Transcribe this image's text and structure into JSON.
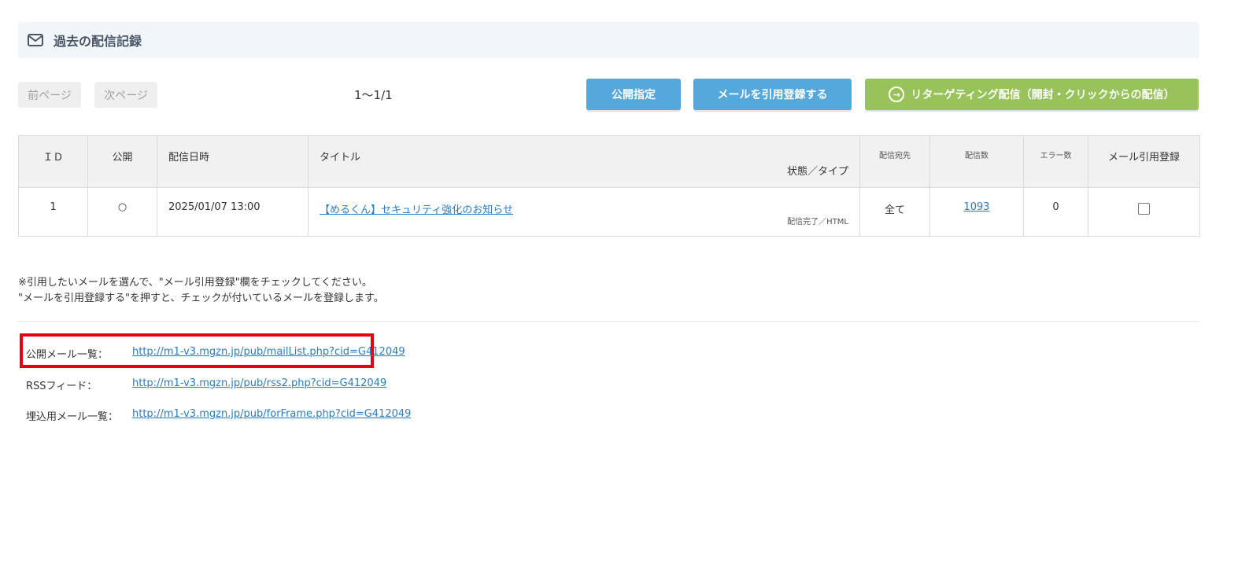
{
  "header": {
    "title": "過去の配信記録",
    "icon": "mail-icon"
  },
  "pager": {
    "prev_label": "前ページ",
    "next_label": "次ページ",
    "page_info": "1〜1/1"
  },
  "actions": {
    "publish_label": "公開指定",
    "quote_register_label": "メールを引用登録する",
    "retargeting_label": "リターゲティング配信（開封・クリックからの配信）",
    "retargeting_icon": "circle-arrow-right-icon"
  },
  "table": {
    "headers": {
      "id": "ＩＤ",
      "public": "公開",
      "date": "配信日時",
      "title": "タイトル",
      "status_type": "状態／タイプ",
      "recipients": "配信宛先",
      "count": "配信数",
      "errors": "エラー数",
      "quote": "メール引用登録"
    },
    "rows": [
      {
        "id": "1",
        "public": "○",
        "date": "2025/01/07 13:00",
        "title": "【めるくん】セキュリティ強化のお知らせ",
        "status_type": "配信完了／HTML",
        "recipients": "全て",
        "count": "1093",
        "errors": "0",
        "quote_checked": false
      }
    ]
  },
  "notes": {
    "line1": "※引用したいメールを選んで、\"メール引用登録\"欄をチェックしてください。",
    "line2": "\"メールを引用登録する\"を押すと、チェックが付いているメールを登録します。"
  },
  "urls": {
    "public_list_label": "公開メール一覧：",
    "public_list_url": "http://m1-v3.mgzn.jp/pub/mailList.php?cid=G412049",
    "rss_label": "RSSフィード：",
    "rss_url": "http://m1-v3.mgzn.jp/pub/rss2.php?cid=G412049",
    "embed_label": "埋込用メール一覧：",
    "embed_url": "http://m1-v3.mgzn.jp/pub/forFrame.php?cid=G412049"
  },
  "colors": {
    "accent_blue": "#55a8dc",
    "accent_green": "#98c25a",
    "highlight_red": "#e60012",
    "link": "#2a7dc4"
  }
}
